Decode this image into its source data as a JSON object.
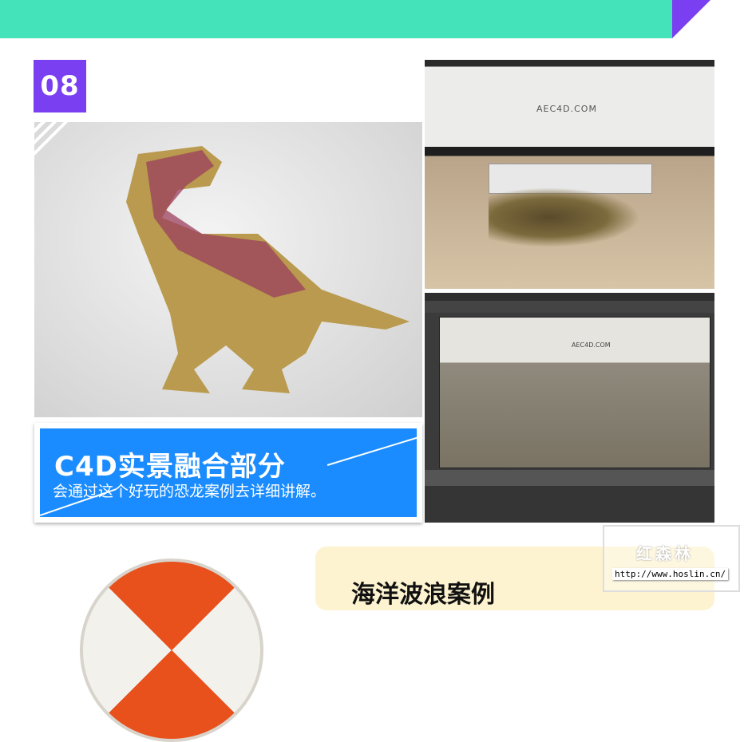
{
  "badge": "08",
  "photo1": {
    "logo_text": "AEC4D.COM"
  },
  "photo2": {
    "logo_text": "AEC4D.COM"
  },
  "caption": {
    "title": "C4D实景融合部分",
    "subtitle": "会通过这个好玩的恐龙案例去详细讲解。"
  },
  "next_section": {
    "title": "海洋波浪案例"
  },
  "watermark": {
    "name": "红森林",
    "url": "http://www.hoslin.cn/"
  },
  "colors": {
    "teal": "#45e3b9",
    "purple": "#7a3ff0",
    "blue": "#1a8cff",
    "card": "#fdf3d0"
  }
}
